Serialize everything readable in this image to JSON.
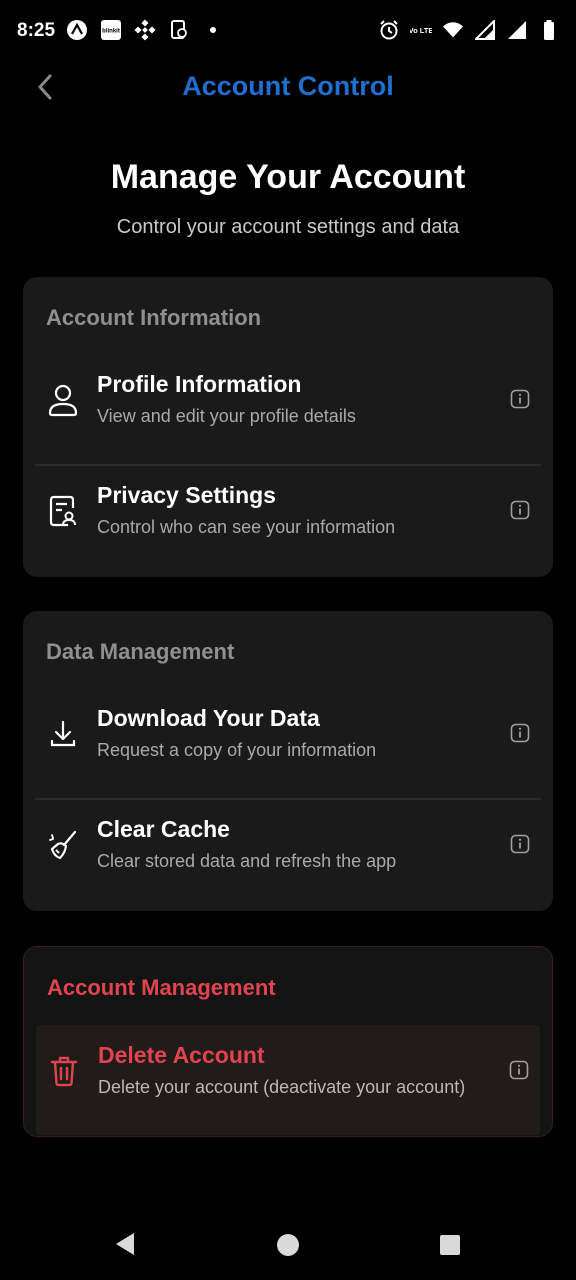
{
  "status_bar": {
    "time": "8:25",
    "left_icons": [
      "app-a-icon",
      "blinkit-icon",
      "binance-icon",
      "clipboard-phone-icon",
      "dot-icon"
    ],
    "blinkit_text": "blinkit",
    "right_icons": [
      "alarm-icon",
      "volte-icon",
      "wifi-icon",
      "signal-icon",
      "signal-icon",
      "battery-icon"
    ],
    "volte_text": "Vo LTE"
  },
  "header": {
    "title": "Account Control",
    "back_icon": "chevron-left-icon",
    "title_color": "#1f6fd1"
  },
  "intro": {
    "title": "Manage Your Account",
    "subtitle": "Control your account settings and data"
  },
  "sections": [
    {
      "title": "Account Information",
      "items": [
        {
          "icon": "user-icon",
          "title": "Profile Information",
          "description": "View and edit your profile details"
        },
        {
          "icon": "privacy-icon",
          "title": "Privacy Settings",
          "description": "Control who can see your information"
        }
      ]
    },
    {
      "title": "Data Management",
      "items": [
        {
          "icon": "download-icon",
          "title": "Download Your Data",
          "description": "Request a copy of your information"
        },
        {
          "icon": "broom-icon",
          "title": "Clear Cache",
          "description": "Clear stored data and refresh the app"
        }
      ]
    },
    {
      "title": "Account Management",
      "items": [
        {
          "icon": "trash-icon",
          "title": "Delete Account",
          "description": "Delete your account (deactivate your account)"
        }
      ]
    }
  ],
  "colors": {
    "accent": "#1f6fd1",
    "danger": "#e0444f",
    "card_bg": "#1a1a1a",
    "page_bg": "#000000"
  },
  "nav_bar": {
    "icons": [
      "nav-back-icon",
      "nav-home-icon",
      "nav-recents-icon"
    ]
  }
}
